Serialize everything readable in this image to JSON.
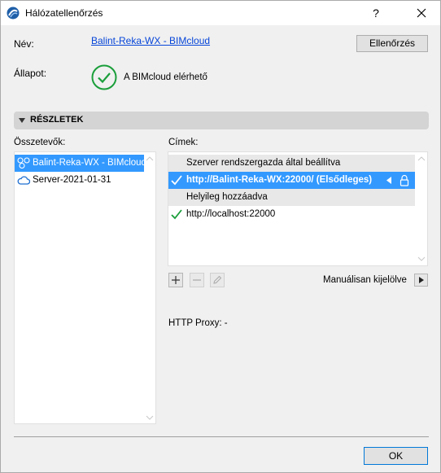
{
  "window": {
    "title": "Hálózatellenőrzés",
    "help": "?"
  },
  "header": {
    "name_label": "Név:",
    "name_value": "Balint-Reka-WX - BIMcloud",
    "check_button": "Ellenőrzés",
    "status_label": "Állapot:",
    "status_text": "A BIMcloud elérhető"
  },
  "details": {
    "title": "RÉSZLETEK"
  },
  "components": {
    "label": "Összetevők:",
    "items": [
      {
        "label": "Balint-Reka-WX - BIMcloud",
        "icon": "bimcloud-icon",
        "selected": true
      },
      {
        "label": "Server-2021-01-31",
        "icon": "cloud-icon",
        "selected": false
      }
    ]
  },
  "addresses": {
    "label": "Címek:",
    "group1": "Szerver rendszergazda által beállítva",
    "row1": "http://Balint-Reka-WX:22000/ (Elsődleges)",
    "group2": "Helyileg hozzáadva",
    "row2": "http://localhost:22000"
  },
  "manual": {
    "label": "Manuálisan kijelölve"
  },
  "proxy": {
    "label": "HTTP Proxy: -"
  },
  "footer": {
    "ok": "OK"
  },
  "colors": {
    "selection": "#3399ff",
    "check": "#1a9e3a",
    "link": "#0645d8"
  }
}
